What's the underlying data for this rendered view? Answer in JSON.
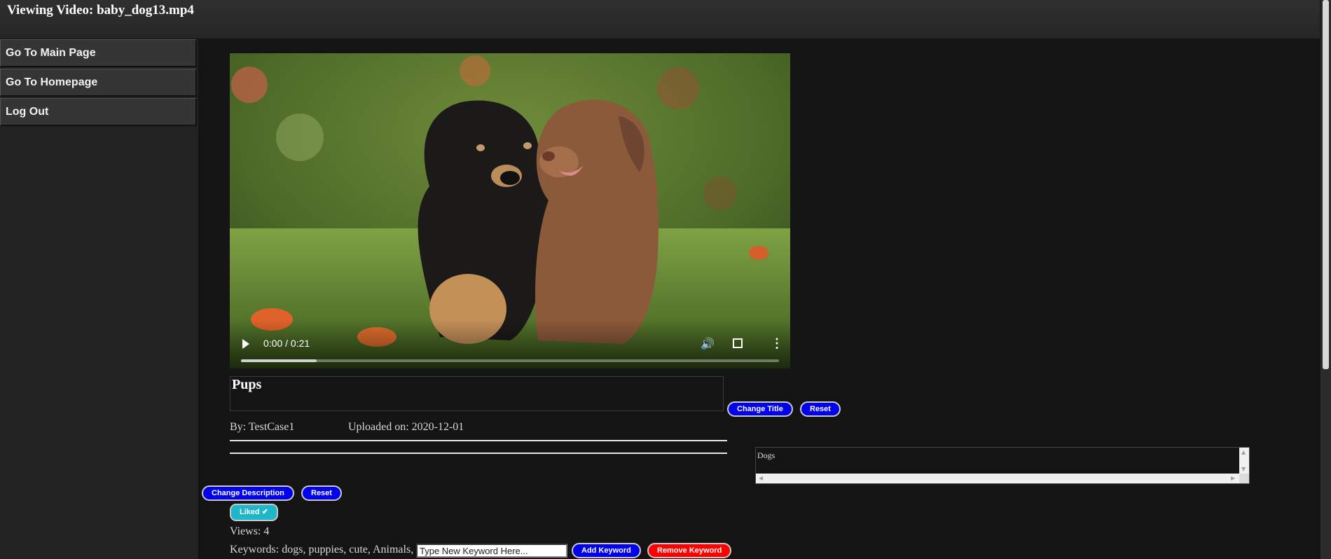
{
  "header": {
    "title": "Viewing Video: baby_dog13.mp4"
  },
  "sidebar": {
    "items": [
      {
        "label": "Go To Main Page"
      },
      {
        "label": "Go To Homepage"
      },
      {
        "label": "Log Out"
      }
    ]
  },
  "video": {
    "current_time": "0:00",
    "duration": "0:21",
    "time_display": "0:00 / 0:21",
    "buffered_fraction": 0.14
  },
  "title_section": {
    "title": "Pups",
    "change_label": "Change Title",
    "reset_label": "Reset"
  },
  "meta": {
    "by": "By: TestCase1",
    "uploaded": "Uploaded on: 2020-12-01"
  },
  "description": {
    "change_label": "Change Description",
    "reset_label": "Reset"
  },
  "categories_box": {
    "text": "Dogs"
  },
  "like": {
    "label": "Liked ✔"
  },
  "views": {
    "text": "Views: 4"
  },
  "keywords": {
    "text": "Keywords: dogs, puppies, cute, Animals,",
    "input_placeholder": "Type New Keyword Here...",
    "add_label": "Add Keyword",
    "remove_label": "Remove Keyword"
  },
  "colors": {
    "accent_blue": "#0000ee",
    "danger_red": "#ff0000",
    "liked_cyan": "#1fb6c9",
    "background": "#141414"
  }
}
